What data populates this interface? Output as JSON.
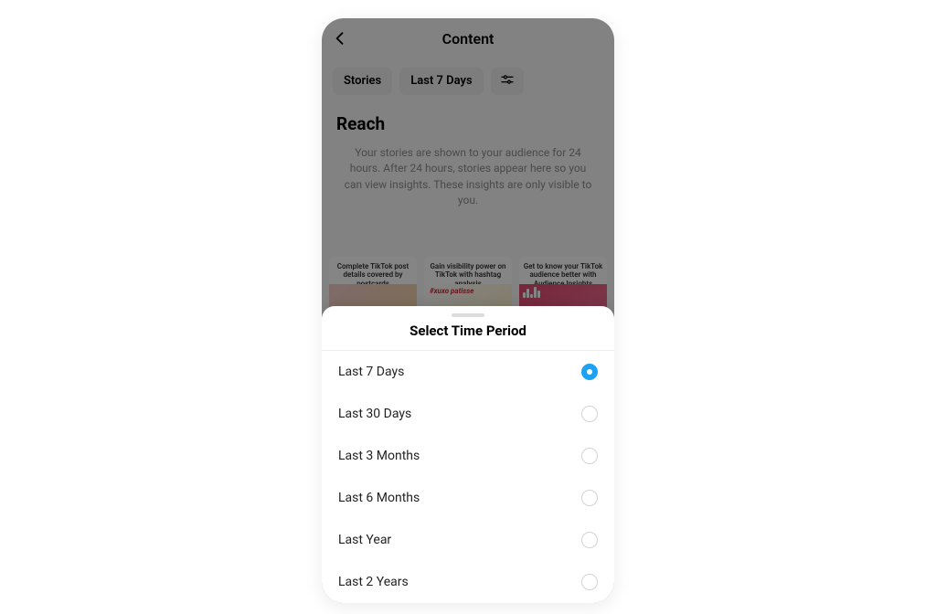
{
  "header": {
    "title": "Content"
  },
  "filters": {
    "chips": [
      "Stories",
      "Last 7 Days"
    ],
    "settingsIcon": "filter-sliders-icon"
  },
  "section": {
    "title": "Reach",
    "description": "Your stories are shown to your audience for 24 hours. After 24 hours, stories appear here so you can view insights. These insights are only visible to you."
  },
  "cards": [
    {
      "title": "Complete TikTok post details covered by postcards",
      "hashtag": ""
    },
    {
      "title": "Gain visibility power on TikTok with hashtag analysis",
      "hashtag": "#xuxo patisse"
    },
    {
      "title": "Get to know your TikTok audience better with Audience Insights",
      "hashtag": ""
    }
  ],
  "sheet": {
    "title": "Select Time Period",
    "options": [
      {
        "label": "Last 7 Days",
        "selected": true
      },
      {
        "label": "Last 30 Days",
        "selected": false
      },
      {
        "label": "Last 3 Months",
        "selected": false
      },
      {
        "label": "Last 6 Months",
        "selected": false
      },
      {
        "label": "Last Year",
        "selected": false
      },
      {
        "label": "Last 2 Years",
        "selected": false
      }
    ]
  }
}
